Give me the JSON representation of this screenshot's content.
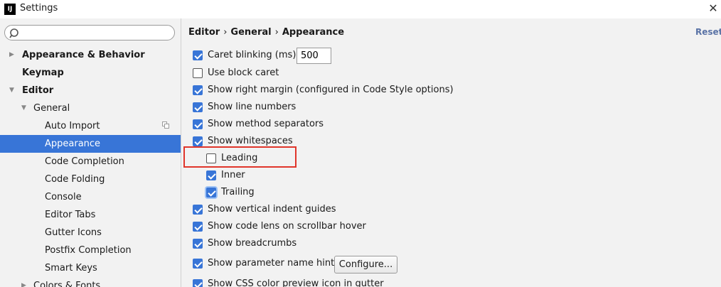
{
  "window": {
    "title": "Settings",
    "close_glyph": "✕"
  },
  "search": {
    "placeholder": "",
    "value": ""
  },
  "sidebar": {
    "items": [
      {
        "label": "Appearance & Behavior",
        "arrow": "▶"
      },
      {
        "label": "Keymap"
      },
      {
        "label": "Editor",
        "arrow": "▼"
      },
      {
        "label": "General",
        "arrow": "▼"
      },
      {
        "label": "Auto Import"
      },
      {
        "label": "Appearance",
        "selected": true
      },
      {
        "label": "Code Completion"
      },
      {
        "label": "Code Folding"
      },
      {
        "label": "Console"
      },
      {
        "label": "Editor Tabs"
      },
      {
        "label": "Gutter Icons"
      },
      {
        "label": "Postfix Completion"
      },
      {
        "label": "Smart Keys"
      },
      {
        "label": "Colors & Fonts",
        "arrow": "▶"
      }
    ]
  },
  "breadcrumb": {
    "parts": [
      "Editor",
      "General",
      "Appearance"
    ],
    "separator": "›"
  },
  "reset_label": "Reset",
  "options": [
    {
      "label": "Caret blinking (ms):",
      "checked": true
    },
    {
      "label": "Use block caret",
      "checked": false
    },
    {
      "label": "Show right margin (configured in Code Style options)",
      "checked": true
    },
    {
      "label": "Show line numbers",
      "checked": true
    },
    {
      "label": "Show method separators",
      "checked": true
    },
    {
      "label": "Show whitespaces",
      "checked": true
    },
    {
      "label": "Leading",
      "checked": false
    },
    {
      "label": "Inner",
      "checked": true
    },
    {
      "label": "Trailing",
      "checked": true
    },
    {
      "label": "Show vertical indent guides",
      "checked": true
    },
    {
      "label": "Show code lens on scrollbar hover",
      "checked": true
    },
    {
      "label": "Show breadcrumbs",
      "checked": true
    },
    {
      "label": "Show parameter name hints",
      "checked": true
    },
    {
      "label": "Show CSS color preview icon in gutter",
      "checked": true
    }
  ],
  "caret_blink_ms": "500",
  "configure_label": "Configure...",
  "colors": {
    "selection": "#3875d7",
    "highlight": "#e0352b",
    "link": "#5a73a6"
  }
}
